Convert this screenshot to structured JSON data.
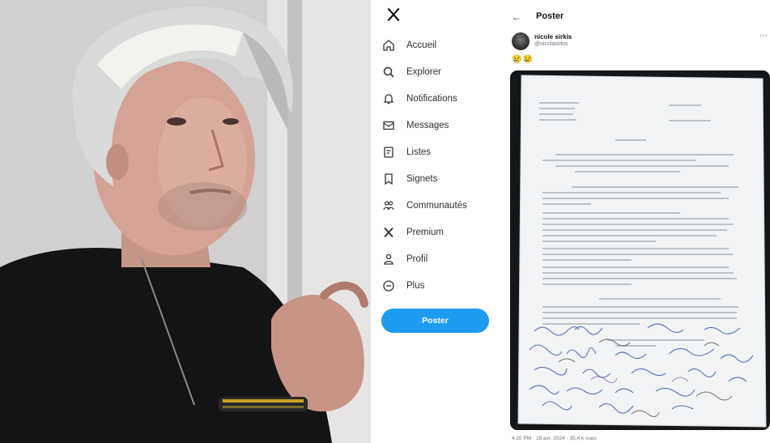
{
  "photo": {
    "description_icon": "portrait-photo"
  },
  "sidebar": {
    "logo_icon": "x-logo-icon",
    "items": [
      {
        "label": "Accueil",
        "icon": "home-icon"
      },
      {
        "label": "Explorer",
        "icon": "search-icon"
      },
      {
        "label": "Notifications",
        "icon": "bell-icon"
      },
      {
        "label": "Messages",
        "icon": "mail-icon"
      },
      {
        "label": "Listes",
        "icon": "list-icon"
      },
      {
        "label": "Signets",
        "icon": "bookmark-icon"
      },
      {
        "label": "Communautés",
        "icon": "communities-icon"
      },
      {
        "label": "Premium",
        "icon": "x-premium-icon"
      },
      {
        "label": "Profil",
        "icon": "profile-icon"
      },
      {
        "label": "Plus",
        "icon": "more-circle-icon"
      }
    ],
    "post_button_label": "Poster",
    "accent_color": "#1d9bf0"
  },
  "post": {
    "back_icon": "←",
    "header_title": "Poster",
    "author_name": "nicole sirkis",
    "author_handle": "@nicolasirkis",
    "more_icon": "···",
    "emojis": "😢😢",
    "attachment_icon": "handwritten-letter-photo",
    "timestamp": "4:20 PM · 16 avr. 2024 · 35,4 k vues"
  }
}
